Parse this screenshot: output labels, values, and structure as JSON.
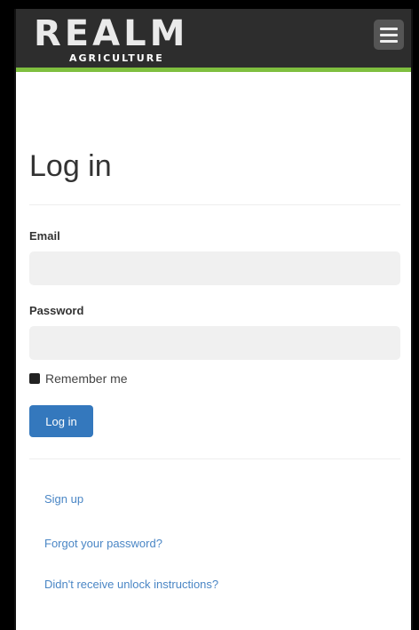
{
  "header": {
    "logo_word": "REALM",
    "logo_sub": "AGRICULTURE",
    "menu_icon": "hamburger-menu-icon",
    "accent_color": "#7fbf3f"
  },
  "main": {
    "title": "Log in",
    "email_label": "Email",
    "email_value": "",
    "password_label": "Password",
    "password_value": "",
    "remember_label": "Remember me",
    "login_button": "Log in",
    "button_color": "#3478bd"
  },
  "links": [
    "Sign up",
    "Forgot your password?",
    "Didn't receive unlock instructions?"
  ]
}
